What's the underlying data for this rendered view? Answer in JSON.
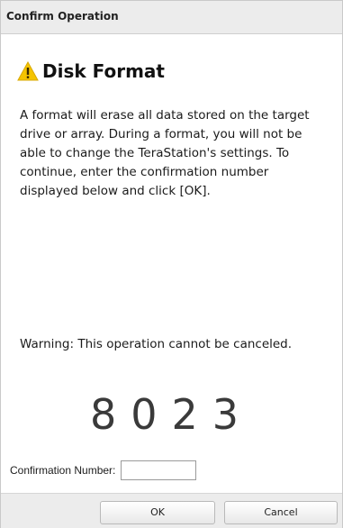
{
  "dialog": {
    "title": "Confirm Operation",
    "heading": "Disk Format",
    "description": "A format will erase all data stored on the target drive or array. During a format, you will not be able to change the TeraStation's settings. To continue, enter the confirmation number displayed below and click [OK].",
    "warning": "Warning: This operation cannot be canceled.",
    "confirmation_code": "8023",
    "confirmation_label": "Confirmation Number:",
    "confirmation_value": "",
    "ok_label": "OK",
    "cancel_label": "Cancel"
  },
  "icons": {
    "heading_icon": "warning-triangle-icon"
  },
  "colors": {
    "warning_icon": "#f5c400",
    "title_bar": "#ececec",
    "footer": "#ececec"
  }
}
